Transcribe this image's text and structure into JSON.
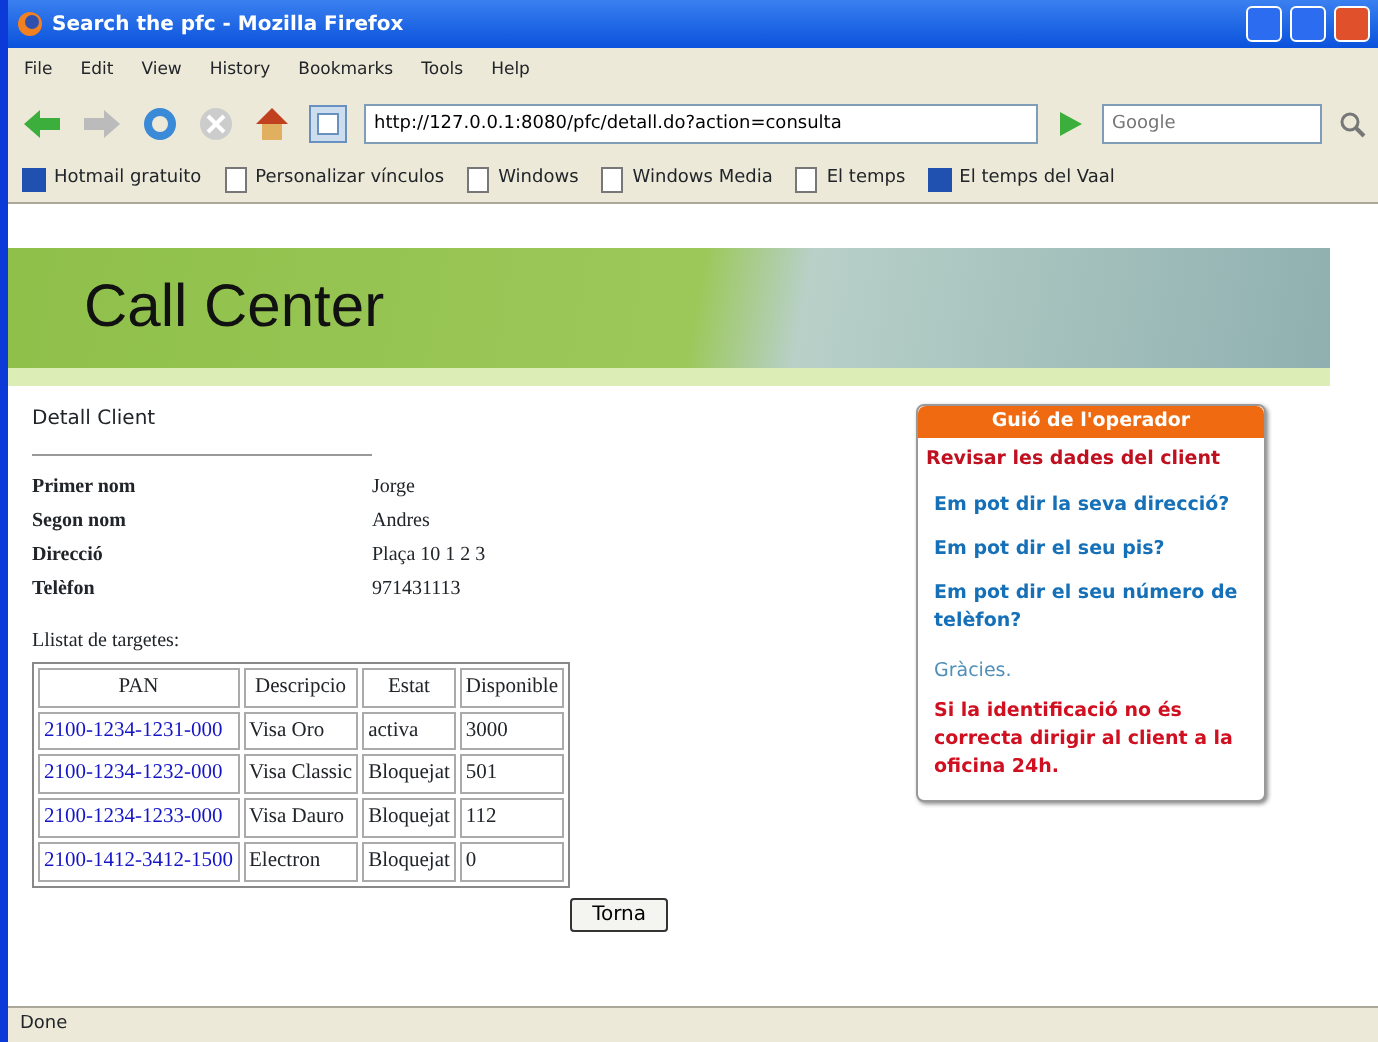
{
  "window": {
    "title": "Search the pfc - Mozilla Firefox"
  },
  "menu": [
    "File",
    "Edit",
    "View",
    "History",
    "Bookmarks",
    "Tools",
    "Help"
  ],
  "address": {
    "value": "http://127.0.0.1:8080/pfc/detall.do?action=consulta"
  },
  "search": {
    "placeholder": "Google"
  },
  "bookmarks": [
    {
      "label": "Hotmail gratuito",
      "kind": "brand"
    },
    {
      "label": "Personalizar vínculos",
      "kind": "page"
    },
    {
      "label": "Windows",
      "kind": "page"
    },
    {
      "label": "Windows Media",
      "kind": "page"
    },
    {
      "label": "El temps",
      "kind": "page"
    },
    {
      "label": "El temps del Vaal",
      "kind": "brand"
    }
  ],
  "banner": {
    "title": "Call Center"
  },
  "client": {
    "heading": "Detall Client",
    "fields": [
      {
        "label": "Primer nom",
        "value": "Jorge"
      },
      {
        "label": "Segon nom",
        "value": "Andres"
      },
      {
        "label": "Direcció",
        "value": "Plaça 10 1 2 3"
      },
      {
        "label": "Telèfon",
        "value": "971431113"
      }
    ]
  },
  "cards": {
    "caption": "Llistat de targetes:",
    "columns": [
      "PAN",
      "Descripcio",
      "Estat",
      "Disponible"
    ],
    "rows": [
      [
        "2100-1234-1231-000",
        "Visa Oro",
        "activa",
        "3000"
      ],
      [
        "2100-1234-1232-000",
        "Visa Classic",
        "Bloquejat",
        "501"
      ],
      [
        "2100-1234-1233-000",
        "Visa Dauro",
        "Bloquejat",
        "112"
      ],
      [
        "2100-1412-3412-1500",
        "Electron",
        "Bloquejat",
        "0"
      ]
    ]
  },
  "back_button": "Torna",
  "guide": {
    "title": "Guió de l'operador",
    "items": [
      {
        "text": "Revisar les dades del client",
        "kind": "step"
      },
      {
        "text": "Em pot dir la seva direcció?",
        "kind": "question"
      },
      {
        "text": "Em pot dir el seu pis?",
        "kind": "question"
      },
      {
        "text": "Em pot dir el seu número de telèfon?",
        "kind": "question"
      },
      {
        "text": "Gràcies.",
        "kind": "plain"
      },
      {
        "text": "Si la identificació no és correcta dirigir al client a la oficina 24h.",
        "kind": "warning"
      }
    ]
  },
  "status_bar": "Done"
}
